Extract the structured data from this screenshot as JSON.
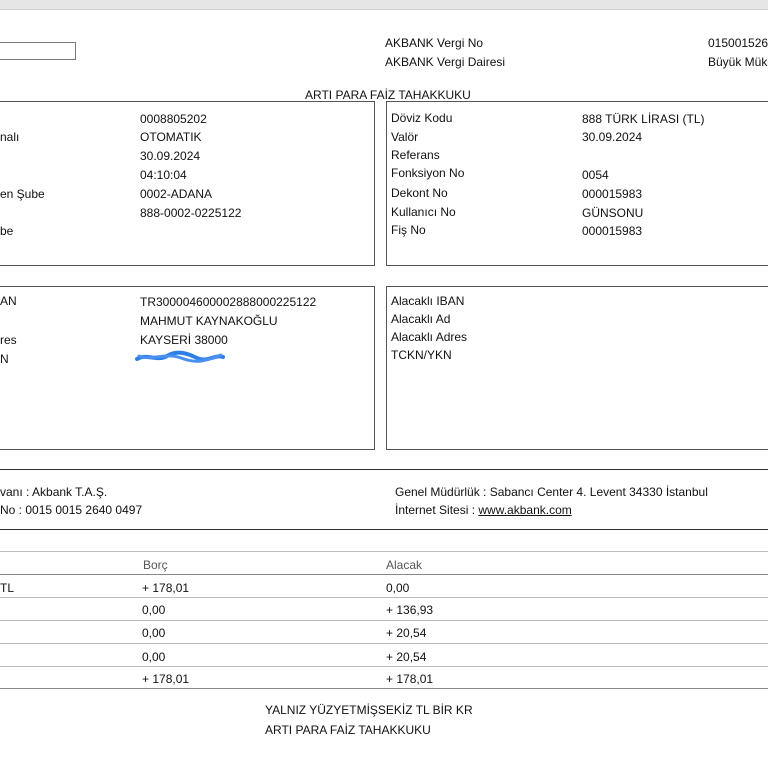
{
  "header": {
    "vergi_no_label": "AKBANK Vergi No",
    "vergi_no_value": "015001526",
    "vergi_dairesi_label": "AKBANK Vergi Dairesi",
    "vergi_dairesi_value": "Büyük Mükel"
  },
  "document_title": "ARTI PARA FAİZ TAHAKKUKU",
  "left_box_1": {
    "labels": [
      "nalı",
      "en Şube",
      "be"
    ],
    "values": [
      "0008805202",
      "OTOMATIK",
      "30.09.2024",
      "04:10:04",
      "0002-ADANA",
      "888-0002-0225122"
    ]
  },
  "right_box_1": {
    "rows": [
      {
        "label": "Döviz Kodu",
        "value": "888 TÜRK LİRASI (TL)"
      },
      {
        "label": "Valör",
        "value": "30.09.2024"
      },
      {
        "label": "Referans",
        "value": ""
      },
      {
        "label": "Fonksiyon No",
        "value": "0054"
      },
      {
        "label": "Dekont No",
        "value": "000015983"
      },
      {
        "label": "Kullanıcı No",
        "value": "GÜNSONU"
      },
      {
        "label": "Fiş No",
        "value": "000015983"
      }
    ]
  },
  "left_box_2": {
    "labels": [
      "AN",
      "res",
      "N"
    ],
    "values": [
      "TR300004600002888000225122",
      "MAHMUT KAYNAKOĞLU",
      "KAYSERİ 38000"
    ]
  },
  "right_box_2": {
    "labels": [
      "Alacaklı IBAN",
      "Alacaklı Ad",
      "Alacaklı Adres",
      "TCKN/YKN"
    ]
  },
  "company": {
    "unvan": "vanı : Akbank T.A.Ş.",
    "no": "No : 0015 0015 2640 0497",
    "genel_mudurluk": "Genel Müdürlük : Sabancı Center 4. Levent 34330 İstanbul",
    "internet_label": "İnternet Sitesi : ",
    "internet_value": "www.akbank.com"
  },
  "table": {
    "headers": {
      "borc": "Borç",
      "alacak": "Alacak"
    },
    "rows": [
      {
        "label": "TL",
        "borc": "+ 178,01",
        "alacak": "0,00"
      },
      {
        "label": "",
        "borc": "0,00",
        "alacak": "+ 136,93"
      },
      {
        "label": "",
        "borc": "0,00",
        "alacak": "+ 20,54"
      },
      {
        "label": "",
        "borc": "0,00",
        "alacak": "+ 20,54"
      },
      {
        "label": "",
        "borc": "+ 178,01",
        "alacak": "+ 178,01"
      }
    ]
  },
  "footer": {
    "amount_words": "YALNIZ YÜZYETMİŞSEKİZ TL BİR KR",
    "title": "ARTI PARA FAİZ TAHAKKUKU"
  }
}
